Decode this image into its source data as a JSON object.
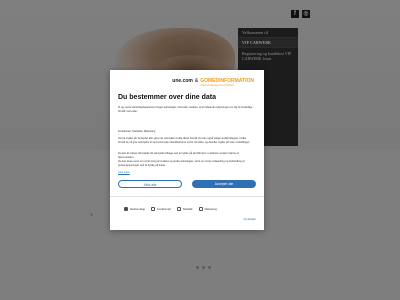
{
  "social": [
    "f",
    "◎"
  ],
  "side_menu": {
    "items": [
      "Velkommen til",
      "VIP CARWERK"
    ],
    "description": "Registrering og kundekort VIP CARWERK frisør"
  },
  "modal": {
    "brand": {
      "name": "une.com",
      "amp": "&",
      "partner": "GOMEDINFORMATION",
      "partner_sub": "A Brand Management Platform"
    },
    "title": "Du bestemmer over dine data",
    "intro": "Vi og vores samarbejdspartnere bruger teknologier, herunder cookies, til at indsamle oplysninger om dig til forskellige formål, herunder:",
    "purposes": "Funktionelt, Statistisk, Marketing",
    "paragraphs": [
      "Ved at trykke på 'Accepter alle' giver du samtykke til alle disse formål. Du kan også vælge at tilkendegive, hvilke formål du vil give samtykke til ved at benytte checkboksene ud for formålet, og derefter trykke på 'Gem indstillinger'.",
      "Du kan til enhver tid trække dit samtykke tilbage ved at trykke på det lille ikon i nederste venstre hjørne af hjemmesiden.",
      "Du kan læse mere om vores brug af cookies og andre teknologier, samt om vores indsamling og behandling af personoplysninger ved at trykke på linket."
    ],
    "link": "Læs mere",
    "reject_label": "Afvis alle",
    "accept_label": "Accepter alle",
    "checkboxes": [
      {
        "label": "Nødvendige",
        "checked": true
      },
      {
        "label": "Funktionelt",
        "checked": false
      },
      {
        "label": "Statistik",
        "checked": false
      },
      {
        "label": "Marketing",
        "checked": false
      }
    ],
    "more_label": "Vis detaljer"
  },
  "carousel_dots": 3
}
